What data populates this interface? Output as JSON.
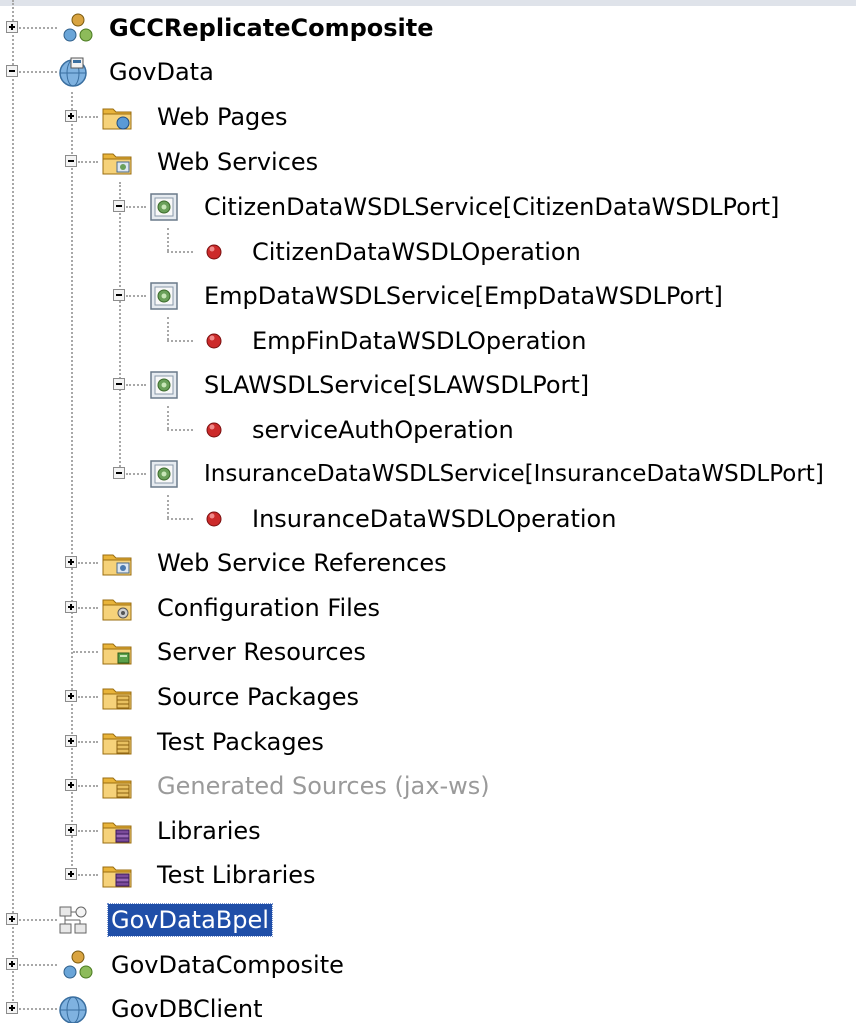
{
  "tree": {
    "nodes": [
      {
        "id": "gccreplicatecomposite",
        "label": "GCCReplicateComposite",
        "icon": "composite-icon",
        "expanded": false
      },
      {
        "id": "govdata",
        "label": "GovData",
        "icon": "globe-project-icon",
        "expanded": true
      },
      {
        "id": "web-pages",
        "label": "Web Pages",
        "icon": "web-pages-folder-icon",
        "expanded": false
      },
      {
        "id": "web-services",
        "label": "Web Services",
        "icon": "web-services-folder-icon",
        "expanded": true
      },
      {
        "id": "citizen-service",
        "label": "CitizenDataWSDLService[CitizenDataWSDLPort]",
        "icon": "web-service-icon",
        "expanded": true
      },
      {
        "id": "citizen-op",
        "label": "CitizenDataWSDLOperation",
        "icon": "operation-icon"
      },
      {
        "id": "emp-service",
        "label": "EmpDataWSDLService[EmpDataWSDLPort]",
        "icon": "web-service-icon",
        "expanded": true
      },
      {
        "id": "emp-op",
        "label": "EmpFinDataWSDLOperation",
        "icon": "operation-icon"
      },
      {
        "id": "sla-service",
        "label": "SLAWSDLService[SLAWSDLPort]",
        "icon": "web-service-icon",
        "expanded": true
      },
      {
        "id": "sla-op",
        "label": "serviceAuthOperation",
        "icon": "operation-icon"
      },
      {
        "id": "insurance-service",
        "label": "InsuranceDataWSDLService[InsuranceDataWSDLPort]",
        "icon": "web-service-icon",
        "expanded": true
      },
      {
        "id": "insurance-op",
        "label": "InsuranceDataWSDLOperation",
        "icon": "operation-icon"
      },
      {
        "id": "ws-references",
        "label": "Web Service References",
        "icon": "ws-references-folder-icon",
        "expanded": false
      },
      {
        "id": "config-files",
        "label": "Configuration Files",
        "icon": "config-folder-icon",
        "expanded": false
      },
      {
        "id": "server-resources",
        "label": "Server Resources",
        "icon": "server-resources-folder-icon"
      },
      {
        "id": "source-packages",
        "label": "Source Packages",
        "icon": "packages-folder-icon",
        "expanded": false
      },
      {
        "id": "test-packages",
        "label": "Test Packages",
        "icon": "packages-folder-icon",
        "expanded": false
      },
      {
        "id": "generated-sources",
        "label": "Generated Sources (jax-ws)",
        "icon": "packages-folder-icon",
        "expanded": false
      },
      {
        "id": "libraries",
        "label": "Libraries",
        "icon": "libraries-folder-icon",
        "expanded": false
      },
      {
        "id": "test-libraries",
        "label": "Test Libraries",
        "icon": "libraries-folder-icon",
        "expanded": false
      },
      {
        "id": "govdatabpel",
        "label": "GovDataBpel",
        "icon": "bpel-project-icon",
        "expanded": false,
        "selected": true
      },
      {
        "id": "govdatacomposite",
        "label": "GovDataComposite",
        "icon": "composite-icon",
        "expanded": false
      },
      {
        "id": "govdbclient",
        "label": "GovDBClient",
        "icon": "globe-project-icon",
        "expanded": false
      }
    ]
  },
  "colors": {
    "selection": "#1f4ea8",
    "disabled_text": "#9a9a9a",
    "folder": "#e9b43a",
    "operation": "#cc2a2a"
  }
}
